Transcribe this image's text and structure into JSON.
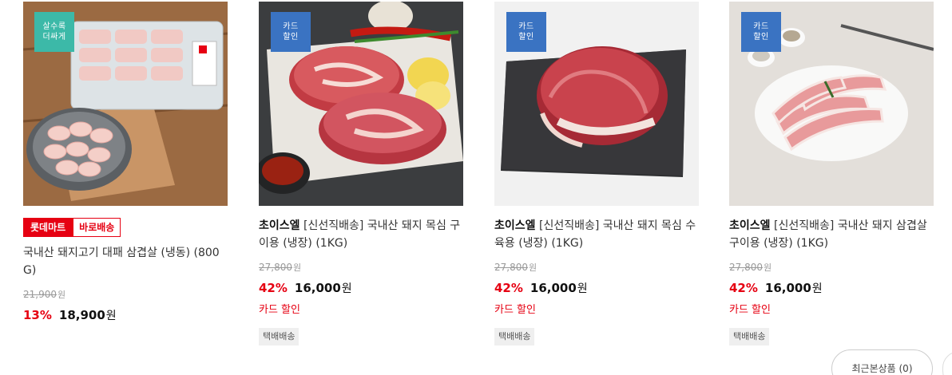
{
  "products": [
    {
      "image_alt": "pork belly in tray",
      "badge": [
        "살수록",
        "더싸게"
      ],
      "badge_color": "#3cb9a8",
      "tags": [
        "롯데마트",
        "바로배송"
      ],
      "brand": "",
      "title": "국내산 돼지고기 대패 삼겹살 (냉동) (800G)",
      "original_price": "21,900",
      "discount": "13%",
      "price": "18,900",
      "currency": "원",
      "card_sale": "",
      "shipping": ""
    },
    {
      "image_alt": "pork neck steaks",
      "badge": [
        "카드",
        "할인"
      ],
      "badge_color": "#3a73c2",
      "tags": [],
      "brand": "초이스엘",
      "title": "[신선직배송] 국내산 돼지 목심 구이용 (냉장) (1KG)",
      "original_price": "27,800",
      "discount": "42%",
      "price": "16,000",
      "currency": "원",
      "card_sale": "카드 할인",
      "shipping": "택배배송"
    },
    {
      "image_alt": "pork neck roast",
      "badge": [
        "카드",
        "할인"
      ],
      "badge_color": "#3a73c2",
      "tags": [],
      "brand": "초이스엘",
      "title": "[신선직배송] 국내산 돼지 목심 수육용 (냉장) (1KG)",
      "original_price": "27,800",
      "discount": "42%",
      "price": "16,000",
      "currency": "원",
      "card_sale": "카드 할인",
      "shipping": "택배배송"
    },
    {
      "image_alt": "pork belly slices on plate",
      "badge": [
        "카드",
        "할인"
      ],
      "badge_color": "#3a73c2",
      "tags": [],
      "brand": "초이스엘",
      "title": "[신선직배송] 국내산 돼지 삼겹살 구이용 (냉장) (1KG)",
      "original_price": "27,800",
      "discount": "42%",
      "price": "16,000",
      "currency": "원",
      "card_sale": "카드 할인",
      "shipping": "택배배송"
    }
  ],
  "recent_viewed": {
    "label": "최근본상품 (0)"
  },
  "colors": {
    "sale_red": "#e60012",
    "badge_teal": "#3cb9a8",
    "badge_blue": "#3a73c2"
  }
}
